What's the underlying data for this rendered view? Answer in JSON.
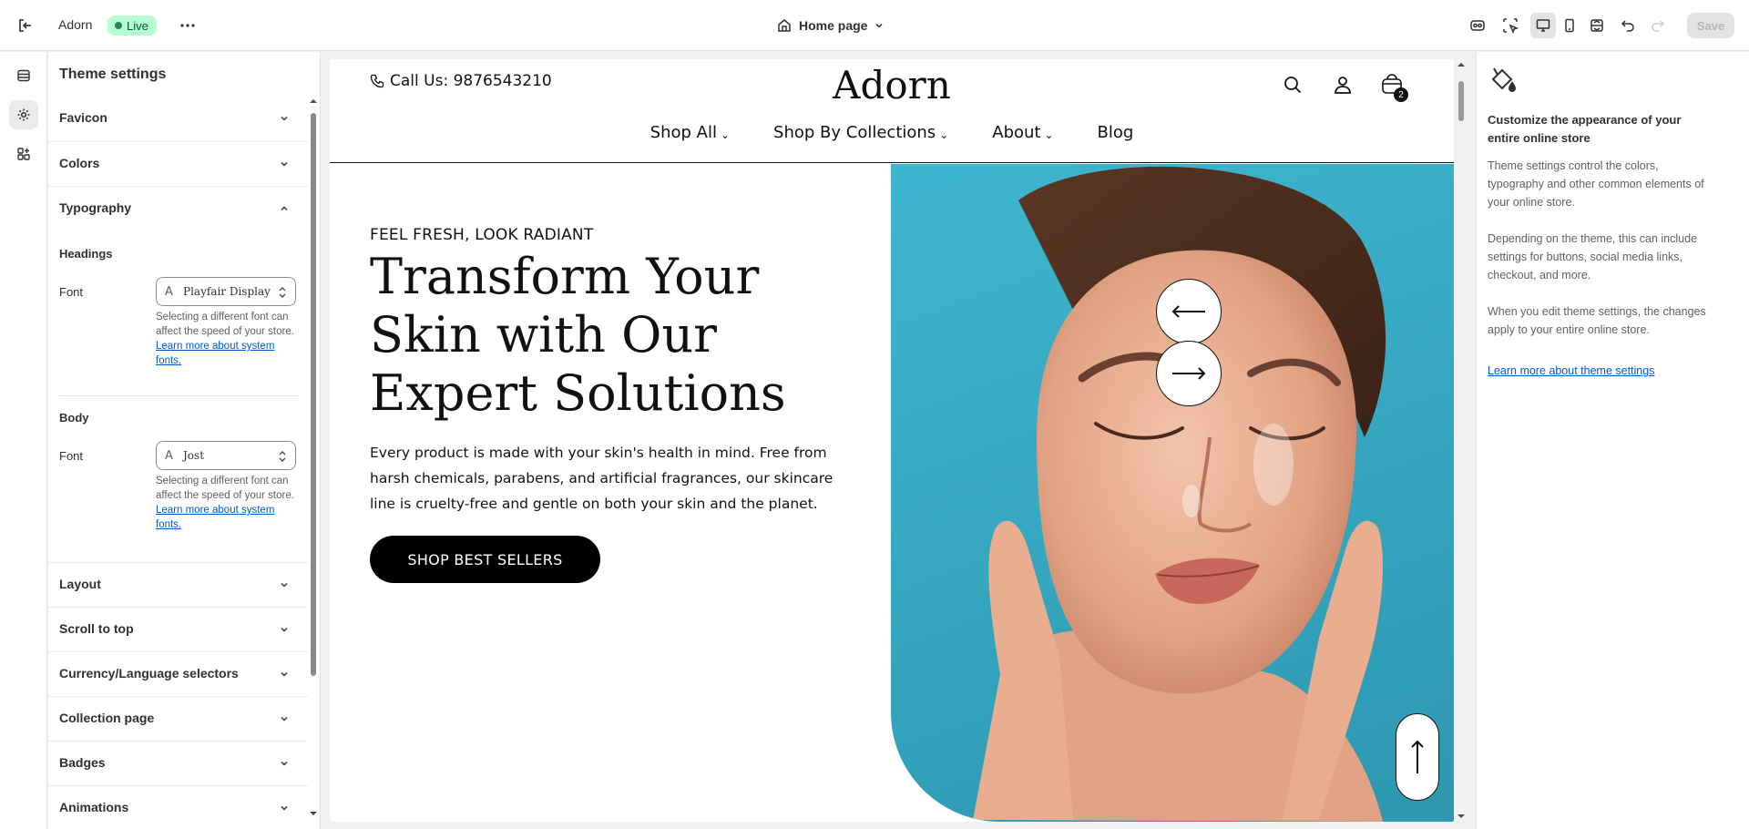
{
  "topbar": {
    "store_name": "Adorn",
    "status_badge": "Live",
    "page_selector": "Home page",
    "save_label": "Save"
  },
  "panel": {
    "title": "Theme settings",
    "sections": [
      {
        "label": "Favicon",
        "expanded": false
      },
      {
        "label": "Colors",
        "expanded": false
      },
      {
        "label": "Typography",
        "expanded": true
      },
      {
        "label": "Layout",
        "expanded": false
      },
      {
        "label": "Scroll to top",
        "expanded": false
      },
      {
        "label": "Currency/Language selectors",
        "expanded": false
      },
      {
        "label": "Collection page",
        "expanded": false
      },
      {
        "label": "Badges",
        "expanded": false
      },
      {
        "label": "Animations",
        "expanded": false
      }
    ],
    "typography": {
      "headings_title": "Headings",
      "headings_font_label": "Font",
      "headings_font_value": "Playfair Display",
      "headings_help": "Selecting a different font can affect the speed of your store.",
      "headings_help_link": "Learn more about system fonts.",
      "body_title": "Body",
      "body_font_label": "Font",
      "body_font_value": "Jost",
      "body_help": "Selecting a different font can affect the speed of your store.",
      "body_help_link": "Learn more about system fonts."
    }
  },
  "preview": {
    "call_us": "Call Us: 9876543210",
    "logo": "Adorn",
    "cart_count": "2",
    "nav": [
      {
        "label": "Shop All",
        "has_dropdown": true
      },
      {
        "label": "Shop By Collections",
        "has_dropdown": true
      },
      {
        "label": "About",
        "has_dropdown": true
      },
      {
        "label": "Blog",
        "has_dropdown": false
      }
    ],
    "hero": {
      "eyebrow": "FEEL FRESH, LOOK RADIANT",
      "heading": "Transform Your Skin with Our Expert Solutions",
      "body": "Every product is made with your skin's health in mind. Free from harsh chemicals, parabens, and artificial fragrances, our skincare line is cruelty-free and gentle on both your skin and the planet.",
      "cta": "SHOP BEST SELLERS"
    }
  },
  "info": {
    "title": "Customize the appearance of your entire online store",
    "p1": "Theme settings control the colors, typography and other common elements of your online store.",
    "p2": "Depending on the theme, this can include settings for buttons, social media links, checkout, and more.",
    "p3": "When you edit theme settings, the changes apply to your entire online store.",
    "link": "Learn more about theme settings"
  },
  "colors": {
    "live_bg": "#b4fed2",
    "link": "#005bd3",
    "hero_bg": "#3fb6cf",
    "cta_bg": "#000000"
  }
}
